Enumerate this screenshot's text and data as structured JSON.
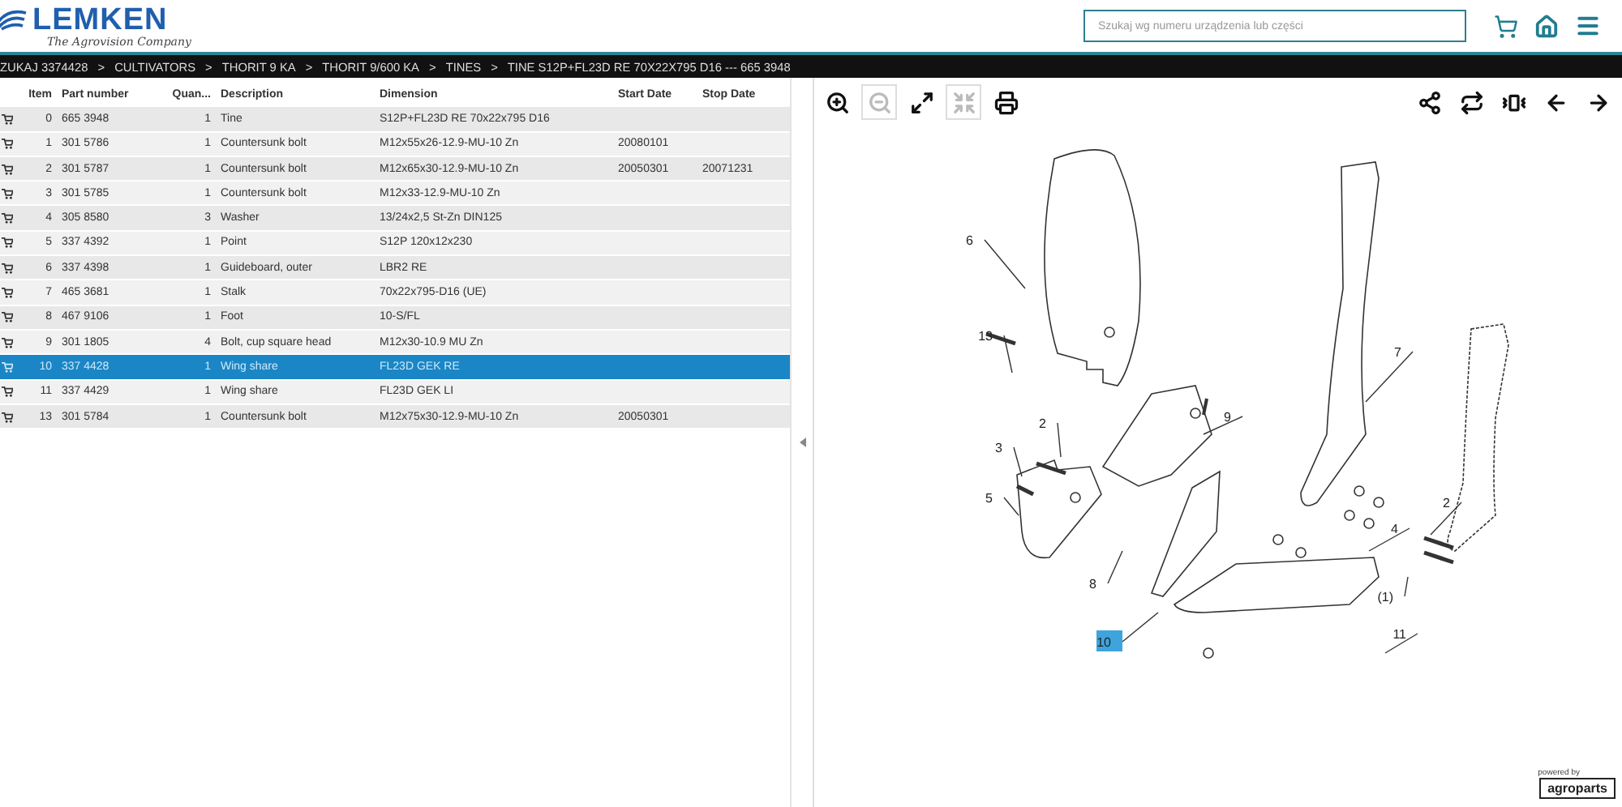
{
  "header": {
    "logo": "LEMKEN",
    "tagline": "The Agrovision Company",
    "search": {
      "placeholder": "Szukaj wg numeru urządzenia lub części"
    }
  },
  "breadcrumb": {
    "separator": ">",
    "items": [
      "ZUKAJ 3374428",
      "CULTIVATORS",
      "THORIT 9 KA",
      "THORIT 9/600 KA",
      "TINES",
      "TINE S12P+FL23D RE 70X22X795 D16 --- 665 3948"
    ]
  },
  "table": {
    "columns": [
      "Item",
      "Part number",
      "Quan...",
      "Description",
      "Dimension",
      "Start Date",
      "Stop Date"
    ],
    "rows": [
      {
        "selected": false,
        "cells": [
          "0",
          "665 3948",
          "1",
          "Tine",
          "S12P+FL23D RE 70x22x795 D16",
          "",
          ""
        ]
      },
      {
        "selected": false,
        "cells": [
          "1",
          "301 5786",
          "1",
          "Countersunk bolt",
          "M12x55x26-12.9-MU-10 Zn",
          "20080101",
          ""
        ]
      },
      {
        "selected": false,
        "cells": [
          "2",
          "301 5787",
          "1",
          "Countersunk bolt",
          "M12x65x30-12.9-MU-10 Zn",
          "20050301",
          "20071231"
        ]
      },
      {
        "selected": false,
        "cells": [
          "3",
          "301 5785",
          "1",
          "Countersunk bolt",
          "M12x33-12.9-MU-10 Zn",
          "",
          ""
        ]
      },
      {
        "selected": false,
        "cells": [
          "4",
          "305 8580",
          "3",
          "Washer",
          "13/24x2,5 St-Zn DIN125",
          "",
          ""
        ]
      },
      {
        "selected": false,
        "cells": [
          "5",
          "337 4392",
          "1",
          "Point",
          "S12P 120x12x230",
          "",
          ""
        ]
      },
      {
        "selected": false,
        "cells": [
          "6",
          "337 4398",
          "1",
          "Guideboard, outer",
          "LBR2 RE",
          "",
          ""
        ]
      },
      {
        "selected": false,
        "cells": [
          "7",
          "465 3681",
          "1",
          "Stalk",
          "70x22x795-D16 (UE)",
          "",
          ""
        ]
      },
      {
        "selected": false,
        "cells": [
          "8",
          "467 9106",
          "1",
          "Foot",
          "10-S/FL",
          "",
          ""
        ]
      },
      {
        "selected": false,
        "cells": [
          "9",
          "301 1805",
          "4",
          "Bolt, cup square head",
          "M12x30-10.9 MU Zn",
          "",
          ""
        ]
      },
      {
        "selected": true,
        "cells": [
          "10",
          "337 4428",
          "1",
          "Wing share",
          "FL23D GEK RE",
          "",
          ""
        ]
      },
      {
        "selected": false,
        "cells": [
          "11",
          "337 4429",
          "1",
          "Wing share",
          "FL23D GEK LI",
          "",
          ""
        ]
      },
      {
        "selected": false,
        "cells": [
          "13",
          "301 5784",
          "1",
          "Countersunk bolt",
          "M12x75x30-12.9-MU-10 Zn",
          "20050301",
          ""
        ]
      }
    ]
  },
  "toolbar": {
    "left": [
      {
        "kind": "zoom-in",
        "disabled": false
      },
      {
        "kind": "zoom-out",
        "disabled": true
      },
      {
        "kind": "expand",
        "disabled": false
      },
      {
        "kind": "fit",
        "disabled": true
      },
      {
        "kind": "print",
        "disabled": false
      }
    ],
    "right": [
      {
        "kind": "share",
        "disabled": false
      },
      {
        "kind": "rotate",
        "disabled": false
      },
      {
        "kind": "vibrate",
        "disabled": false
      },
      {
        "kind": "back",
        "disabled": false
      },
      {
        "kind": "forward",
        "disabled": false
      }
    ]
  },
  "diagram": {
    "callouts": [
      {
        "label": "6",
        "selected": false
      },
      {
        "label": "13",
        "selected": false
      },
      {
        "label": "3",
        "selected": false
      },
      {
        "label": "2",
        "selected": false
      },
      {
        "label": "5",
        "selected": false
      },
      {
        "label": "9",
        "selected": false
      },
      {
        "label": "8",
        "selected": false
      },
      {
        "label": "7",
        "selected": false
      },
      {
        "label": "4",
        "selected": false
      },
      {
        "label": "2",
        "selected": false
      },
      {
        "label": "(1)",
        "selected": false
      },
      {
        "label": "10",
        "selected": true
      },
      {
        "label": "11",
        "selected": false
      }
    ]
  },
  "footer": {
    "powered": "powered by",
    "brand": "agroparts"
  }
}
